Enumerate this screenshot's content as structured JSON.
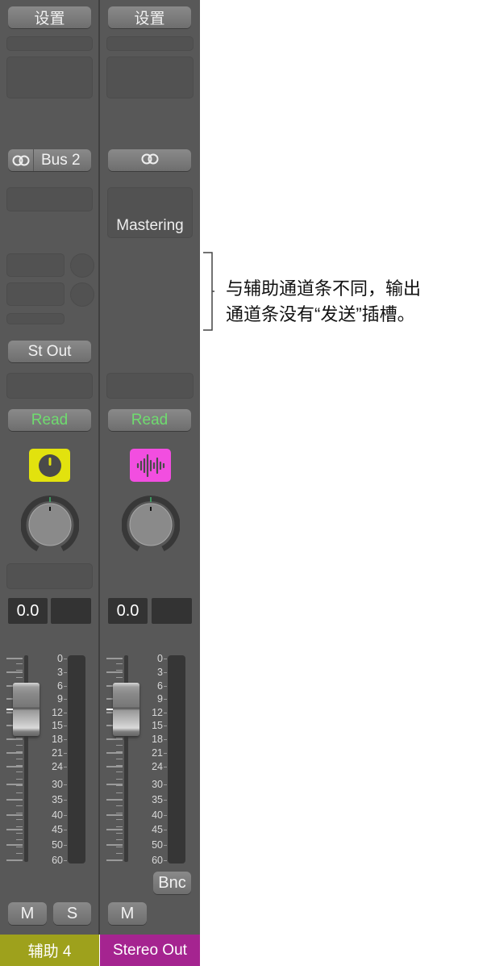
{
  "strips": [
    {
      "settings": "设置",
      "output_label": "Bus 2",
      "io_icon": "link-rings-icon",
      "send_output": "St Out",
      "automation": "Read",
      "icon_color": "#e2e20e",
      "icon": "knob-icon",
      "volume": "0.0",
      "fader_db": "0.0",
      "mute": "M",
      "solo": "S",
      "name": "辅助 4",
      "name_color": "#9ea11c"
    },
    {
      "settings": "设置",
      "io_icon": "link-rings-icon",
      "insert": "Mastering",
      "automation": "Read",
      "icon_color": "#f24ee0",
      "icon": "waveform-icon",
      "volume": "0.0",
      "bounce": "Bnc",
      "mute": "M",
      "name": "Stereo Out",
      "name_color": "#a52490"
    }
  ],
  "meter_scale": [
    "0",
    "3",
    "6",
    "9",
    "12",
    "15",
    "18",
    "21",
    "24",
    "30",
    "35",
    "40",
    "45",
    "50",
    "60"
  ],
  "annotation": {
    "line1": "与辅助通道条不同，输出",
    "line2": "通道条没有“发送”插槽。"
  }
}
